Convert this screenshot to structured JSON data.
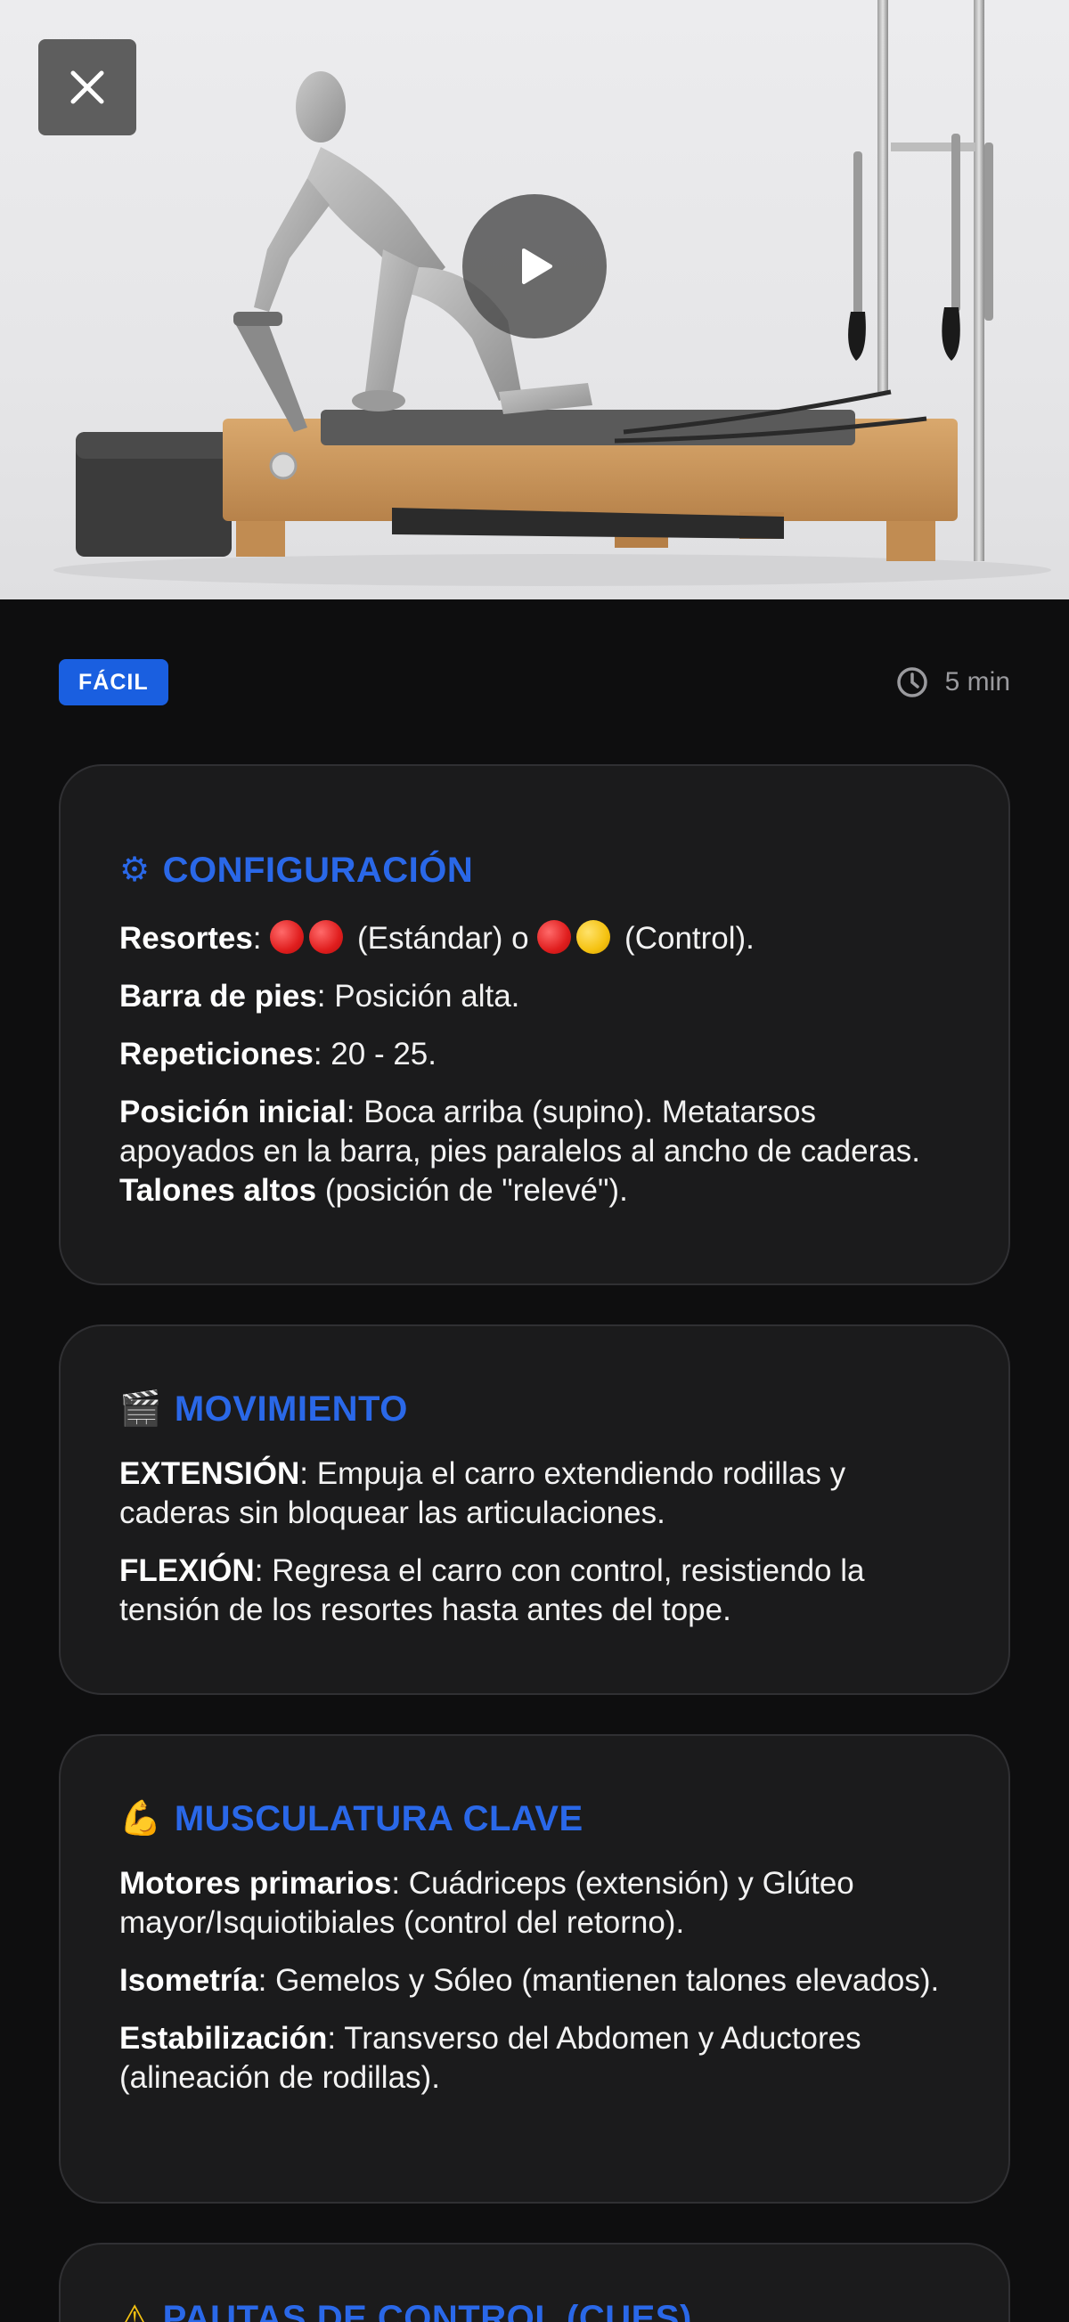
{
  "header": {
    "close_icon": "close-icon",
    "play_icon": "play-icon"
  },
  "meta": {
    "difficulty": "FÁCIL",
    "duration": "5 min",
    "duration_icon": "clock-icon"
  },
  "sections": {
    "config": {
      "icon": "⚙",
      "title": "CONFIGURACIÓN",
      "springs_label": "Resortes",
      "springs_standard": "(Estándar) o",
      "springs_control": "(Control).",
      "footbar_label": "Barra de pies",
      "footbar_value": ": Posición alta.",
      "reps_label": "Repeticiones",
      "reps_value": ": 20 - 25.",
      "start_label": "Posición inicial",
      "start_value": ": Boca arriba (supino). Metatarsos apoyados en la barra, pies paralelos al ancho de caderas.",
      "heels_label": "Talones altos",
      "heels_value": "(posición de \"relevé\")."
    },
    "movement": {
      "icon": "🎬",
      "title": "MOVIMIENTO",
      "ext_label": "EXTENSIÓN",
      "ext_value": ": Empuja el carro extendiendo rodillas y caderas sin bloquear las articulaciones.",
      "flex_label": "FLEXIÓN",
      "flex_value": ": Regresa el carro con control, resistiendo la tensión de los resortes hasta antes del tope."
    },
    "muscles": {
      "icon": "💪",
      "title": "MUSCULATURA CLAVE",
      "primary_label": "Motores primarios",
      "primary_value": ": Cuádriceps (extensión) y Glúteo mayor/Isquiotibiales (control del retorno).",
      "iso_label": "Isometría",
      "iso_value": ": Gemelos y Sóleo (mantienen talones elevados).",
      "stab_label": "Estabilización",
      "stab_value": ": Transverso del Abdomen y Aductores (alineación de rodillas)."
    },
    "cues": {
      "icon": "⚠",
      "title": "PAUTAS DE CONTROL (CUES)"
    }
  },
  "colors": {
    "accent": "#2a68e8",
    "badge": "#1a5fe0",
    "background": "#0e0e0f",
    "card": "#1b1b1c",
    "spring_red": "#e01e1e",
    "spring_yellow": "#f5c211"
  }
}
